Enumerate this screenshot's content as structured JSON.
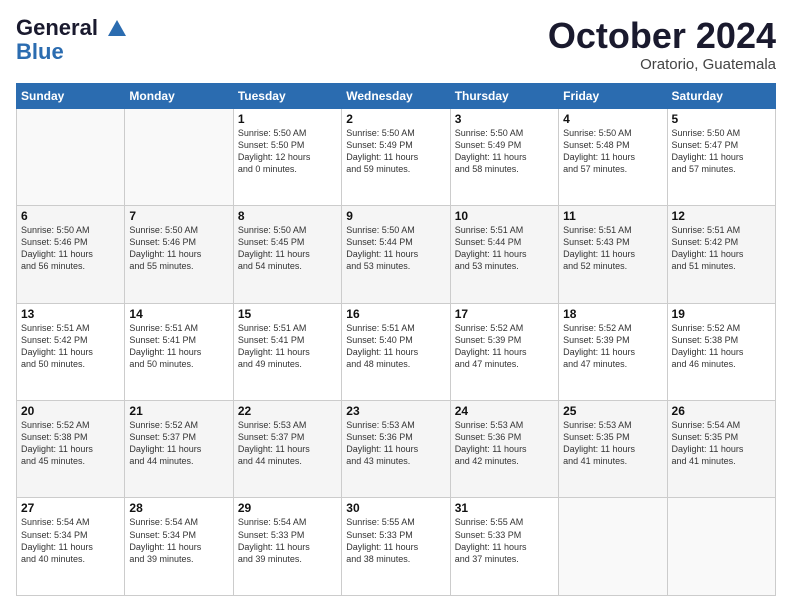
{
  "header": {
    "logo_line1": "General",
    "logo_line2": "Blue",
    "month": "October 2024",
    "location": "Oratorio, Guatemala"
  },
  "days_header": [
    "Sunday",
    "Monday",
    "Tuesday",
    "Wednesday",
    "Thursday",
    "Friday",
    "Saturday"
  ],
  "weeks": [
    [
      {
        "day": "",
        "info": ""
      },
      {
        "day": "",
        "info": ""
      },
      {
        "day": "1",
        "info": "Sunrise: 5:50 AM\nSunset: 5:50 PM\nDaylight: 12 hours\nand 0 minutes."
      },
      {
        "day": "2",
        "info": "Sunrise: 5:50 AM\nSunset: 5:49 PM\nDaylight: 11 hours\nand 59 minutes."
      },
      {
        "day": "3",
        "info": "Sunrise: 5:50 AM\nSunset: 5:49 PM\nDaylight: 11 hours\nand 58 minutes."
      },
      {
        "day": "4",
        "info": "Sunrise: 5:50 AM\nSunset: 5:48 PM\nDaylight: 11 hours\nand 57 minutes."
      },
      {
        "day": "5",
        "info": "Sunrise: 5:50 AM\nSunset: 5:47 PM\nDaylight: 11 hours\nand 57 minutes."
      }
    ],
    [
      {
        "day": "6",
        "info": "Sunrise: 5:50 AM\nSunset: 5:46 PM\nDaylight: 11 hours\nand 56 minutes."
      },
      {
        "day": "7",
        "info": "Sunrise: 5:50 AM\nSunset: 5:46 PM\nDaylight: 11 hours\nand 55 minutes."
      },
      {
        "day": "8",
        "info": "Sunrise: 5:50 AM\nSunset: 5:45 PM\nDaylight: 11 hours\nand 54 minutes."
      },
      {
        "day": "9",
        "info": "Sunrise: 5:50 AM\nSunset: 5:44 PM\nDaylight: 11 hours\nand 53 minutes."
      },
      {
        "day": "10",
        "info": "Sunrise: 5:51 AM\nSunset: 5:44 PM\nDaylight: 11 hours\nand 53 minutes."
      },
      {
        "day": "11",
        "info": "Sunrise: 5:51 AM\nSunset: 5:43 PM\nDaylight: 11 hours\nand 52 minutes."
      },
      {
        "day": "12",
        "info": "Sunrise: 5:51 AM\nSunset: 5:42 PM\nDaylight: 11 hours\nand 51 minutes."
      }
    ],
    [
      {
        "day": "13",
        "info": "Sunrise: 5:51 AM\nSunset: 5:42 PM\nDaylight: 11 hours\nand 50 minutes."
      },
      {
        "day": "14",
        "info": "Sunrise: 5:51 AM\nSunset: 5:41 PM\nDaylight: 11 hours\nand 50 minutes."
      },
      {
        "day": "15",
        "info": "Sunrise: 5:51 AM\nSunset: 5:41 PM\nDaylight: 11 hours\nand 49 minutes."
      },
      {
        "day": "16",
        "info": "Sunrise: 5:51 AM\nSunset: 5:40 PM\nDaylight: 11 hours\nand 48 minutes."
      },
      {
        "day": "17",
        "info": "Sunrise: 5:52 AM\nSunset: 5:39 PM\nDaylight: 11 hours\nand 47 minutes."
      },
      {
        "day": "18",
        "info": "Sunrise: 5:52 AM\nSunset: 5:39 PM\nDaylight: 11 hours\nand 47 minutes."
      },
      {
        "day": "19",
        "info": "Sunrise: 5:52 AM\nSunset: 5:38 PM\nDaylight: 11 hours\nand 46 minutes."
      }
    ],
    [
      {
        "day": "20",
        "info": "Sunrise: 5:52 AM\nSunset: 5:38 PM\nDaylight: 11 hours\nand 45 minutes."
      },
      {
        "day": "21",
        "info": "Sunrise: 5:52 AM\nSunset: 5:37 PM\nDaylight: 11 hours\nand 44 minutes."
      },
      {
        "day": "22",
        "info": "Sunrise: 5:53 AM\nSunset: 5:37 PM\nDaylight: 11 hours\nand 44 minutes."
      },
      {
        "day": "23",
        "info": "Sunrise: 5:53 AM\nSunset: 5:36 PM\nDaylight: 11 hours\nand 43 minutes."
      },
      {
        "day": "24",
        "info": "Sunrise: 5:53 AM\nSunset: 5:36 PM\nDaylight: 11 hours\nand 42 minutes."
      },
      {
        "day": "25",
        "info": "Sunrise: 5:53 AM\nSunset: 5:35 PM\nDaylight: 11 hours\nand 41 minutes."
      },
      {
        "day": "26",
        "info": "Sunrise: 5:54 AM\nSunset: 5:35 PM\nDaylight: 11 hours\nand 41 minutes."
      }
    ],
    [
      {
        "day": "27",
        "info": "Sunrise: 5:54 AM\nSunset: 5:34 PM\nDaylight: 11 hours\nand 40 minutes."
      },
      {
        "day": "28",
        "info": "Sunrise: 5:54 AM\nSunset: 5:34 PM\nDaylight: 11 hours\nand 39 minutes."
      },
      {
        "day": "29",
        "info": "Sunrise: 5:54 AM\nSunset: 5:33 PM\nDaylight: 11 hours\nand 39 minutes."
      },
      {
        "day": "30",
        "info": "Sunrise: 5:55 AM\nSunset: 5:33 PM\nDaylight: 11 hours\nand 38 minutes."
      },
      {
        "day": "31",
        "info": "Sunrise: 5:55 AM\nSunset: 5:33 PM\nDaylight: 11 hours\nand 37 minutes."
      },
      {
        "day": "",
        "info": ""
      },
      {
        "day": "",
        "info": ""
      }
    ]
  ]
}
